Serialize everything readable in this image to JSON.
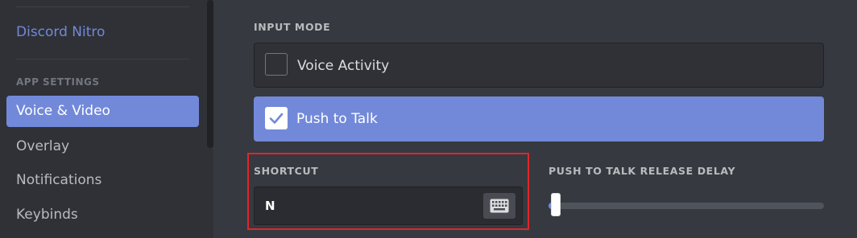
{
  "sidebar": {
    "nitro_label": "Discord Nitro",
    "app_settings_header": "APP SETTINGS",
    "items": [
      {
        "label": "Voice & Video",
        "selected": true
      },
      {
        "label": "Overlay",
        "selected": false
      },
      {
        "label": "Notifications",
        "selected": false
      },
      {
        "label": "Keybinds",
        "selected": false
      }
    ]
  },
  "input_mode": {
    "title": "INPUT MODE",
    "options": [
      {
        "label": "Voice Activity",
        "checked": false
      },
      {
        "label": "Push to Talk",
        "checked": true
      }
    ]
  },
  "shortcut": {
    "title": "SHORTCUT",
    "value": "N",
    "button_icon": "keyboard-icon"
  },
  "release_delay": {
    "title": "PUSH TO TALK RELEASE DELAY",
    "value_fraction": 0.0
  },
  "colors": {
    "accent": "#7289da",
    "background": "#36393f",
    "sidebar": "#2f3136",
    "highlight": "#e0262b"
  }
}
